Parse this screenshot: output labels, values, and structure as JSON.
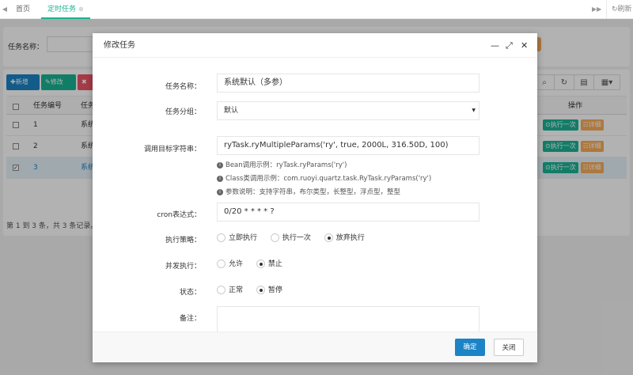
{
  "tabs": {
    "home": "首页",
    "active": "定时任务",
    "refresh": "刷新"
  },
  "background": {
    "search_label": "任务名称：",
    "buttons": {
      "add": "新增",
      "edit": "修改"
    },
    "columns": {
      "id": "任务编号",
      "group": "任务",
      "actions": "操作"
    },
    "rows": [
      {
        "id": "1",
        "name": "系统",
        "checked": false,
        "selected": false
      },
      {
        "id": "2",
        "name": "系统",
        "checked": false,
        "selected": false
      },
      {
        "id": "3",
        "name": "系统",
        "checked": true,
        "selected": true
      }
    ],
    "row_actions": {
      "run": "执行一次",
      "detail": "详细"
    },
    "pagination": "第 1 到 3 条，共 3 条记录。"
  },
  "modal": {
    "title": "修改任务",
    "labels": {
      "job_name": "任务名称：",
      "job_group": "任务分组：",
      "invoke_target": "调用目标字符串：",
      "cron": "cron表达式：",
      "misfire": "执行策略：",
      "concurrent": "并发执行：",
      "status": "状态：",
      "remark": "备注："
    },
    "values": {
      "job_name": "系统默认（多参）",
      "job_group": "默认",
      "invoke_target": "ryTask.ryMultipleParams('ry', true, 2000L, 316.50D, 100)",
      "cron": "0/20 * * * * ?"
    },
    "help": [
      "Bean调用示例：ryTask.ryParams('ry')",
      "Class类调用示例：com.ruoyi.quartz.task.RyTask.ryParams('ry')",
      "参数说明：支持字符串，布尔类型，长整型，浮点型，整型"
    ],
    "misfire_options": [
      "立即执行",
      "执行一次",
      "放弃执行"
    ],
    "misfire_selected": "放弃执行",
    "concurrent_options": [
      "允许",
      "禁止"
    ],
    "concurrent_selected": "禁止",
    "status_options": [
      "正常",
      "暂停"
    ],
    "status_selected": "暂停",
    "ok": "确定",
    "close": "关闭"
  },
  "colors": {
    "primary": "#1c84c6",
    "success": "#1ab394",
    "warning": "#f8ac59",
    "danger": "#ed5565"
  }
}
